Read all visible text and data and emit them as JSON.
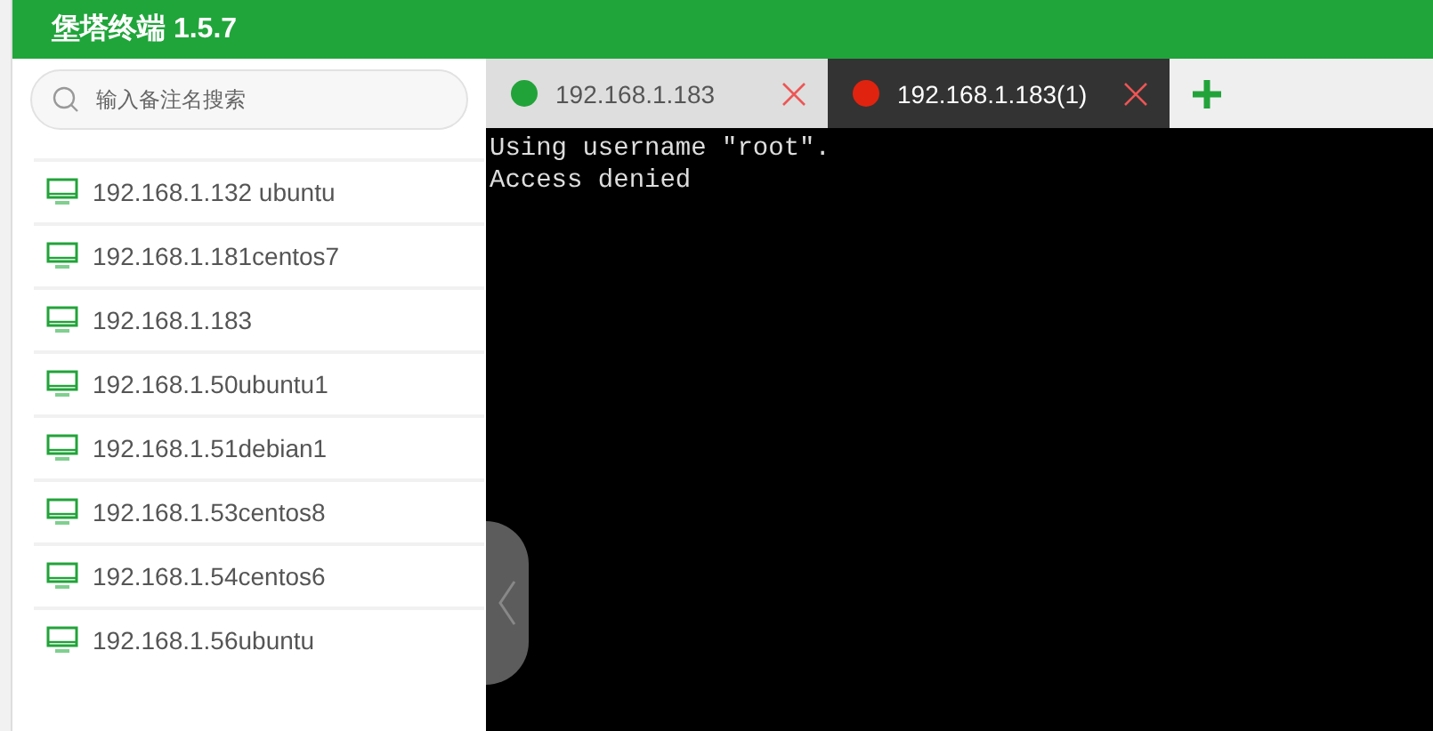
{
  "window": {
    "title": "堡塔终端 1.5.7"
  },
  "sidebar": {
    "search": {
      "placeholder": "输入备注名搜索"
    },
    "hosts": [
      {
        "label": "192.168.1.132 ubuntu"
      },
      {
        "label": "192.168.1.181centos7"
      },
      {
        "label": "192.168.1.183"
      },
      {
        "label": "192.168.1.50ubuntu1"
      },
      {
        "label": "192.168.1.51debian1"
      },
      {
        "label": "192.168.1.53centos8"
      },
      {
        "label": "192.168.1.54centos6"
      },
      {
        "label": "192.168.1.56ubuntu"
      }
    ]
  },
  "tabs": [
    {
      "label": "192.168.1.183",
      "selected": false,
      "color": "#22a33a"
    },
    {
      "label": "192.168.1.183(1)",
      "selected": true,
      "color": "#e0230f"
    }
  ],
  "terminal": {
    "lines": [
      "Using username \"root\".",
      "Access denied"
    ]
  }
}
